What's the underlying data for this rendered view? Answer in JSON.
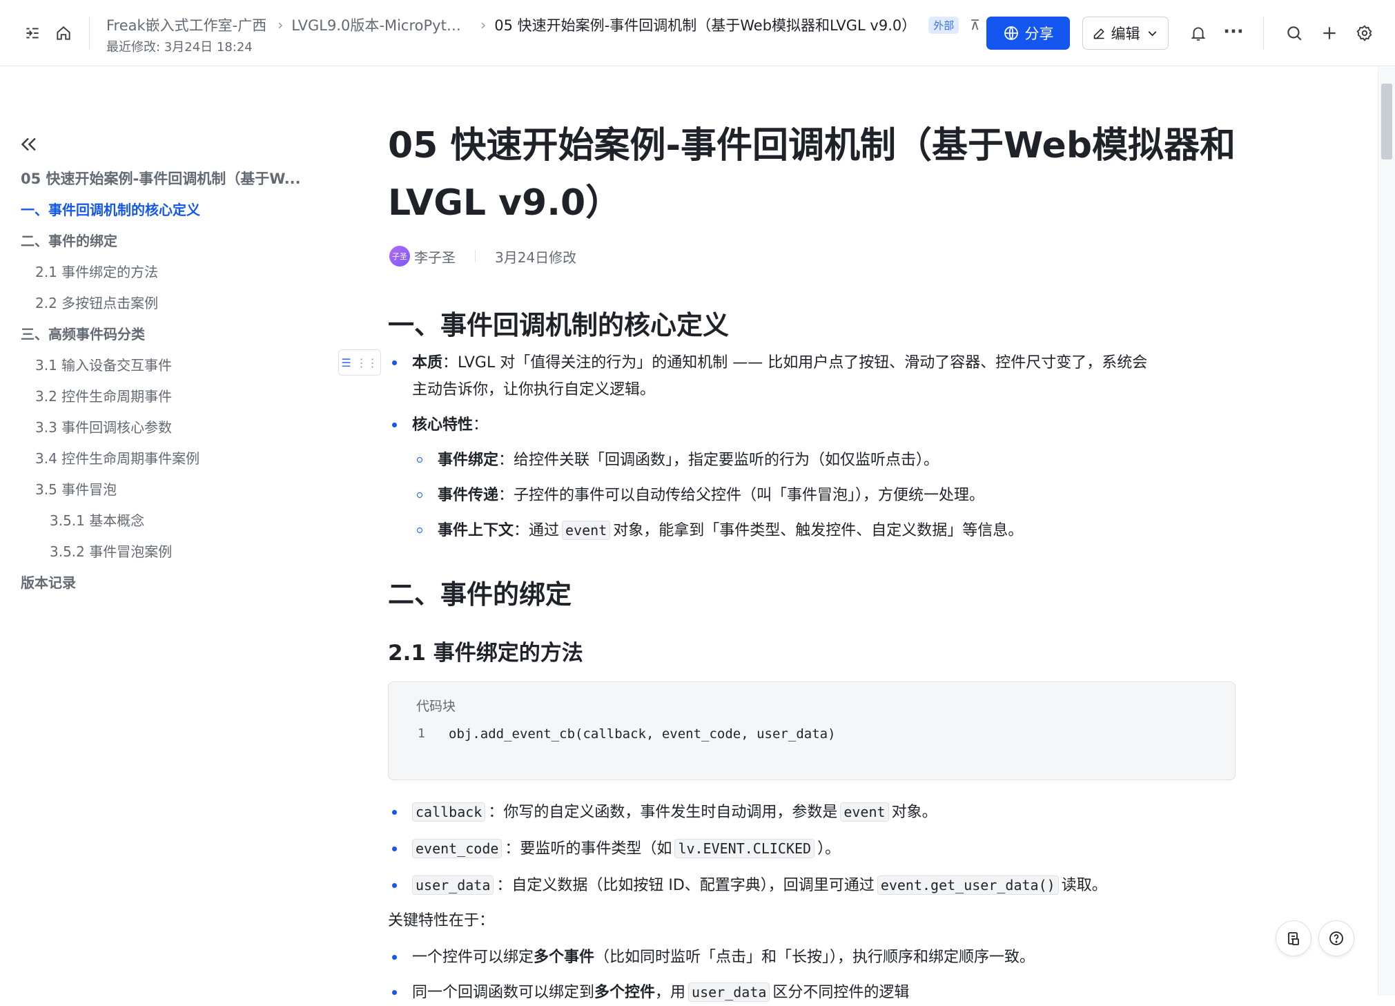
{
  "header": {
    "breadcrumbs": [
      "Freak嵌入式工作室-广西",
      "LVGL9.0版本-MicroPython...",
      "05 快速开始案例-事件回调机制（基于Web模拟器和LVGL v9.0）"
    ],
    "badge": "外部",
    "modified": "最近修改: 3月24日 18:24",
    "share_label": "分享",
    "edit_label": "编辑",
    "more": "···"
  },
  "toc": {
    "items": [
      {
        "label": "05 快速开始案例-事件回调机制（基于W...",
        "level": "title"
      },
      {
        "label": "一、事件回调机制的核心定义",
        "level": "l1",
        "active": true
      },
      {
        "label": "二、事件的绑定",
        "level": "l1"
      },
      {
        "label": "2.1 事件绑定的方法",
        "level": "l2"
      },
      {
        "label": "2.2 多按钮点击案例",
        "level": "l2"
      },
      {
        "label": "三、高频事件码分类",
        "level": "l1"
      },
      {
        "label": "3.1 输入设备交互事件",
        "level": "l2"
      },
      {
        "label": "3.2 控件生命周期事件",
        "level": "l2"
      },
      {
        "label": "3.3 事件回调核心参数",
        "level": "l2"
      },
      {
        "label": "3.4 控件生命周期事件案例",
        "level": "l2"
      },
      {
        "label": "3.5 事件冒泡",
        "level": "l2"
      },
      {
        "label": "3.5.1 基本概念",
        "level": "l3"
      },
      {
        "label": "3.5.2 事件冒泡案例",
        "level": "l3"
      },
      {
        "label": "版本记录",
        "level": "l1"
      }
    ]
  },
  "doc": {
    "title_line1": "05 快速开始案例-事件回调机制（基于Web模拟器和",
    "title_line2": "LVGL v9.0）",
    "author": "李子圣",
    "avatar_text": "子圣",
    "date": "3月24日修改",
    "h1_a": "一、事件回调机制的核心定义",
    "essence_label": "本质",
    "essence_text_1": "：LVGL 对「值得关注的行为」的通知机制 —— 比如用户点了按钮、滑动了容器、控件尺寸变了，系统会",
    "essence_text_2": "主动告诉你，让你执行自定义逻辑。",
    "core_label": "核心特性",
    "core_colon": "：",
    "bind_label": "事件绑定",
    "bind_text": "：给控件关联「回调函数」，指定要监听的行为（如仅监听点击）。",
    "pass_label": "事件传递",
    "pass_text": "：子控件的事件可以自动传给父控件（叫「事件冒泡」），方便统一处理。",
    "ctx_label": "事件上下文",
    "ctx_text_1": "：通过",
    "ctx_code": "event",
    "ctx_text_2": "对象，能拿到「事件类型、触发控件、自定义数据」等信息。",
    "h1_b": "二、事件的绑定",
    "h2_a": "2.1 事件绑定的方法",
    "code_label": "代码块",
    "code_line_no": "1",
    "code_line": "obj.add_event_cb(callback, event_code, user_data)",
    "cb_code": "callback",
    "cb_text_1": "：你写的自定义函数，事件发生时自动调用，参数是",
    "cb_code2": "event",
    "cb_text_2": "对象。",
    "ec_code": "event_code",
    "ec_text_1": "：要监听的事件类型（如",
    "ec_code2": "lv.EVENT.CLICKED",
    "ec_text_2": "）。",
    "ud_code": "user_data",
    "ud_text_1": "：自定义数据（比如按钮 ID、配置字典），回调里可通过",
    "ud_code2": "event.get_user_data()",
    "ud_text_2": "读取。",
    "key_text": "关键特性在于：",
    "multi_text_1": "一个控件可以绑定",
    "multi_bold": "多个事件",
    "multi_text_2": "（比如同时监听「点击」和「长按」），执行顺序和绑定顺序一致。",
    "same_text_1": "同一个回调函数可以绑定到",
    "same_bold": "多个控件",
    "same_text_2": "，用",
    "same_code": "user_data",
    "same_text_3": "区分不同控件的逻辑"
  },
  "colors": {
    "accent": "#1456f0",
    "badge_bg": "#e1eaff"
  }
}
